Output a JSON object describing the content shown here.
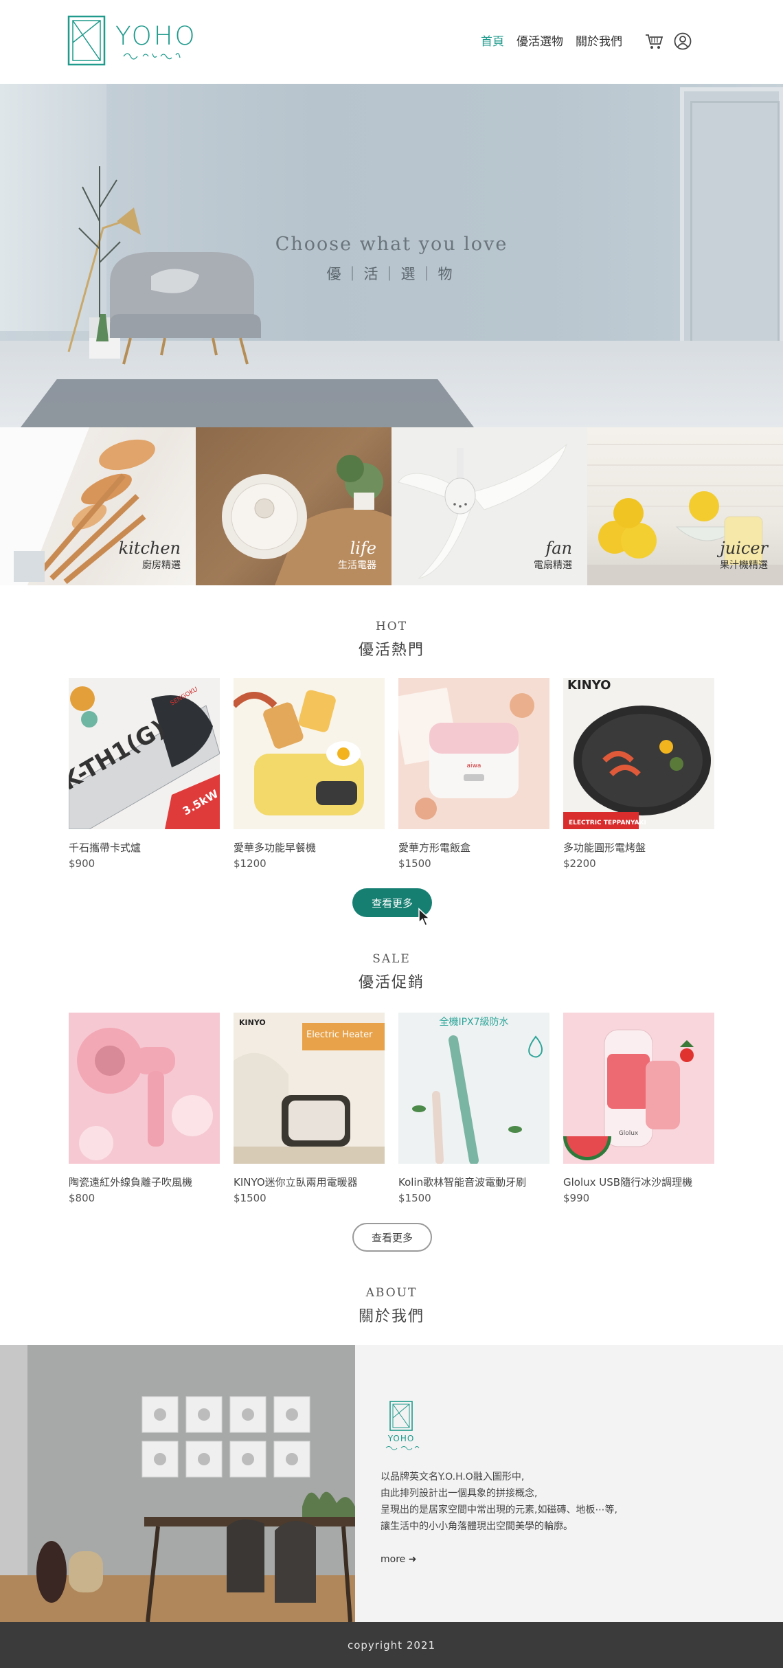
{
  "header": {
    "logo_text": "YOHO",
    "logo_script": "x2-x",
    "nav": [
      {
        "label": "首頁",
        "active": true
      },
      {
        "label": "優活選物",
        "active": false
      },
      {
        "label": "關於我們",
        "active": false
      }
    ],
    "icons": [
      "cart-icon",
      "user-icon"
    ]
  },
  "hero": {
    "title": "Choose what you love",
    "subtitle": "優｜活｜選｜物"
  },
  "categories": [
    {
      "en": "kitchen",
      "zh": "廚房精選"
    },
    {
      "en": "life",
      "zh": "生活電器"
    },
    {
      "en": "fan",
      "zh": "電扇精選"
    },
    {
      "en": "juicer",
      "zh": "果汁機精選"
    }
  ],
  "hot": {
    "en": "HOT",
    "zh": "優活熱門",
    "products": [
      {
        "name": "千石攜帶卡式爐",
        "price": "$900",
        "img_text": "K-TH1(G)",
        "img_text2": "SENGOKU",
        "img_text3": "3.5kW"
      },
      {
        "name": "愛華多功能早餐機",
        "price": "$1200"
      },
      {
        "name": "愛華方形電飯盒",
        "price": "$1500",
        "img_text": "aiwa"
      },
      {
        "name": "多功能圓形電烤盤",
        "price": "$2200",
        "img_text": "KINYO",
        "img_text2": "ELECTRIC TEPPANYAKI"
      }
    ],
    "button": "查看更多"
  },
  "sale": {
    "en": "SALE",
    "zh": "優活促銷",
    "products": [
      {
        "name": "陶瓷遠紅外線負離子吹風機",
        "price": "$800"
      },
      {
        "name": "KINYO迷你立臥兩用電暖器",
        "price": "$1500",
        "img_text": "KINYO",
        "img_text2": "Electric Heater"
      },
      {
        "name": "Kolin歌林智能音波電動牙刷",
        "price": "$1500",
        "img_text": "全機IPX7級防水"
      },
      {
        "name": "Glolux USB隨行冰沙調理機",
        "price": "$990",
        "img_text": "Glolux"
      }
    ],
    "button": "查看更多"
  },
  "about": {
    "en": "ABOUT",
    "zh": "關於我們",
    "logo_text": "YOHO",
    "lines": [
      "以品牌英文名Y.O.H.O融入圖形中,",
      "由此排列設計出一個具象的拼接概念,",
      "呈現出的是居家空間中常出現的元素,如磁磚、地板⋯等,",
      "讓生活中的小小角落體現出空間美學的輪廓。"
    ],
    "more": "more ➜"
  },
  "footer": {
    "text": "copyright 2021"
  },
  "colors": {
    "accent": "#1f9a8c",
    "button": "#167f72",
    "footer": "#3b3b3b"
  }
}
